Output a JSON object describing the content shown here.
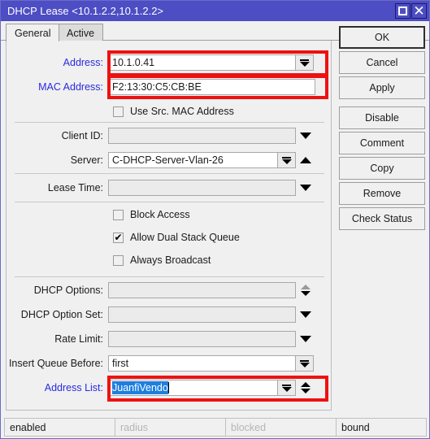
{
  "window": {
    "title": "DHCP Lease <10.1.2.2,10.1.2.2>",
    "maximize_icon": "maximize-icon",
    "close_icon": "close-icon",
    "titlebar_color": "#4d4dc4",
    "highlight_color": "#ee1111",
    "selection_color": "#1d7fe0",
    "link_label_color": "#2a2ae0"
  },
  "tabs": [
    {
      "label": "General",
      "active": true
    },
    {
      "label": "Active",
      "active": false
    }
  ],
  "form": {
    "fields": [
      {
        "label": "Address:",
        "value": "10.1.0.41",
        "placeholder": "",
        "widget": "combo-drop",
        "filled": true,
        "highlighted": true,
        "label_blue": true
      },
      {
        "label": "MAC Address:",
        "value": "F2:13:30:C5:CB:BE",
        "placeholder": "",
        "widget": "none",
        "filled": true,
        "highlighted": true,
        "label_blue": true
      },
      {
        "label": "Client ID:",
        "value": "",
        "placeholder": "",
        "widget": "arrow-down",
        "filled": false,
        "highlighted": false,
        "label_blue": false
      },
      {
        "label": "Server:",
        "value": "C-DHCP-Server-Vlan-26",
        "placeholder": "",
        "widget": "combo-drop-up",
        "filled": true,
        "highlighted": false,
        "label_blue": false
      },
      {
        "label": "Lease Time:",
        "value": "",
        "placeholder": "",
        "widget": "arrow-down",
        "filled": false,
        "highlighted": false,
        "label_blue": false
      },
      {
        "label": "DHCP Options:",
        "value": "",
        "placeholder": "",
        "widget": "spinner-grey",
        "filled": false,
        "highlighted": false,
        "label_blue": false
      },
      {
        "label": "DHCP Option Set:",
        "value": "",
        "placeholder": "",
        "widget": "arrow-down",
        "filled": false,
        "highlighted": false,
        "label_blue": false
      },
      {
        "label": "Rate Limit:",
        "value": "",
        "placeholder": "",
        "widget": "arrow-down",
        "filled": false,
        "highlighted": false,
        "label_blue": false
      },
      {
        "label": "Insert Queue Before:",
        "value": "first",
        "placeholder": "",
        "widget": "combo-drop",
        "filled": true,
        "highlighted": false,
        "label_blue": false
      },
      {
        "label": "Address List:",
        "value": "JuanfiVendo",
        "placeholder": "",
        "widget": "combo-spin",
        "filled": true,
        "highlighted": true,
        "label_blue": true,
        "selected": true
      }
    ],
    "checkboxes": [
      {
        "label": "Use Src. MAC Address",
        "checked": false
      },
      {
        "label": "Block Access",
        "checked": false
      },
      {
        "label": "Allow Dual Stack Queue",
        "checked": true,
        "mark": "✔"
      },
      {
        "label": "Always Broadcast",
        "checked": false
      }
    ]
  },
  "buttons": [
    {
      "label": "OK",
      "default": true
    },
    {
      "label": "Cancel",
      "default": false
    },
    {
      "label": "Apply",
      "default": false
    },
    {
      "label": "Disable",
      "default": false
    },
    {
      "label": "Comment",
      "default": false
    },
    {
      "label": "Copy",
      "default": false
    },
    {
      "label": "Remove",
      "default": false
    },
    {
      "label": "Check Status",
      "default": false
    }
  ],
  "statusbar": {
    "cells": [
      {
        "text": "enabled",
        "dim": false
      },
      {
        "text": "radius",
        "dim": true
      },
      {
        "text": "blocked",
        "dim": true
      },
      {
        "text": "bound",
        "dim": false
      }
    ]
  }
}
